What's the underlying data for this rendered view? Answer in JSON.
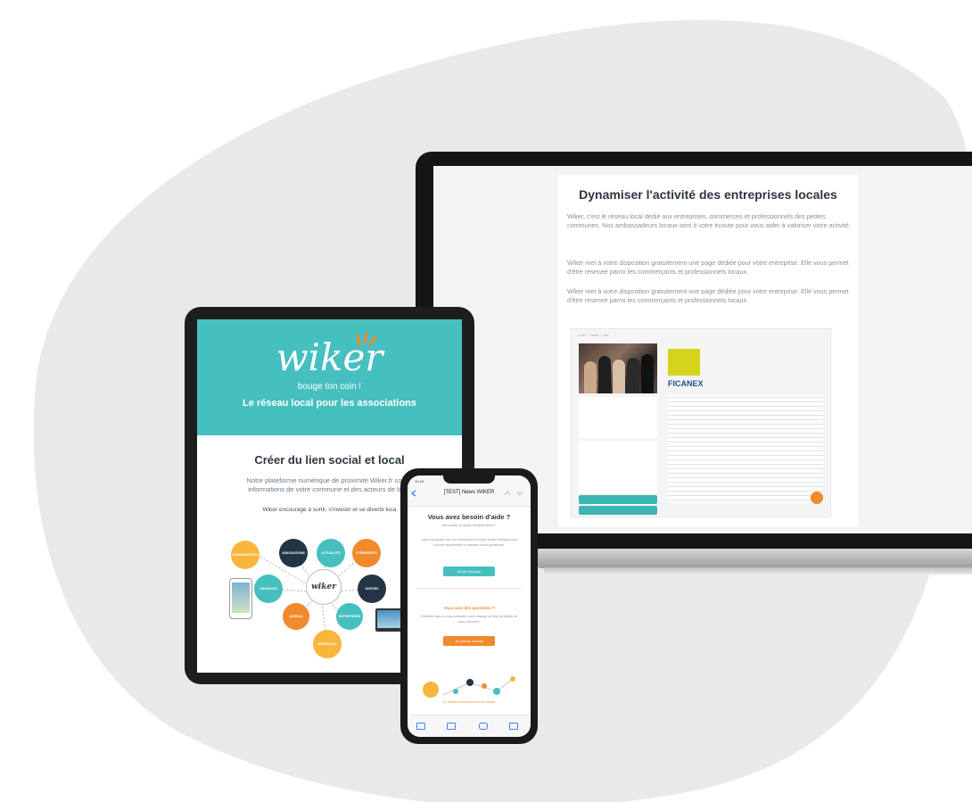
{
  "colors": {
    "teal": "#46bfbf",
    "orange": "#f08a2c",
    "dark": "#1d1d1d",
    "blob": "#e9e9e9",
    "navy": "#2c3640"
  },
  "laptop": {
    "title": "Dynamiser l'activité des entreprises locales",
    "paragraph1": "Wiker, c'est le réseau local dédié aux entreprises, commerces et professionnels des petites communes. Nos ambassadeurs locaux sont à votre écoute pour vous aider à valoriser votre activité.",
    "paragraph2": "Wiker met à votre disposition gratuitement une page dédiée pour votre entreprise. Elle vous permet d'être reseneé parmi les commerçants et professionnels locaux.",
    "paragraph3": "Wiker met à votre disposition gratuitement une page dédiée pour votre entreprise. Elle vous permet d'être reseneé parmi les commerçants et professionnels locaux.",
    "preview_brand": "FICANEX",
    "preview_section": "Horaires"
  },
  "tablet": {
    "logo": "wiker",
    "tagline": "bouge ton coin !",
    "subtitle": "Le réseau local pour les associations",
    "title": "Créer du lien social et local",
    "text_line1": "Notre plateforme numérique de proximité Wiker.fr compi",
    "text_line2": "informations de votre commune et des acteurs de la co",
    "text_line3": "Wiker encourage à sortir, s'investir et se divertir loca"
  },
  "phone": {
    "status_time": "10:18",
    "nav_title": "[TEST] News WIKER",
    "heading": "Vous avez besoin d'aide ?",
    "subheading": "Demandez le mode d'emploi Wiker !",
    "body": "Lisez nos guide par nos ressources et notre mode d'emploi pour trouver rapidement le réponse à vos questions.",
    "button1": "Mode d'emploi",
    "question": "Vous avez des questions ?",
    "question_body": "N'hésitez pas à nous contacter, notre équipe se fera un plaisir de vous répondre.",
    "button2": "Je prends contact",
    "footer_caption": "Le réseau local pour tout le monde"
  }
}
